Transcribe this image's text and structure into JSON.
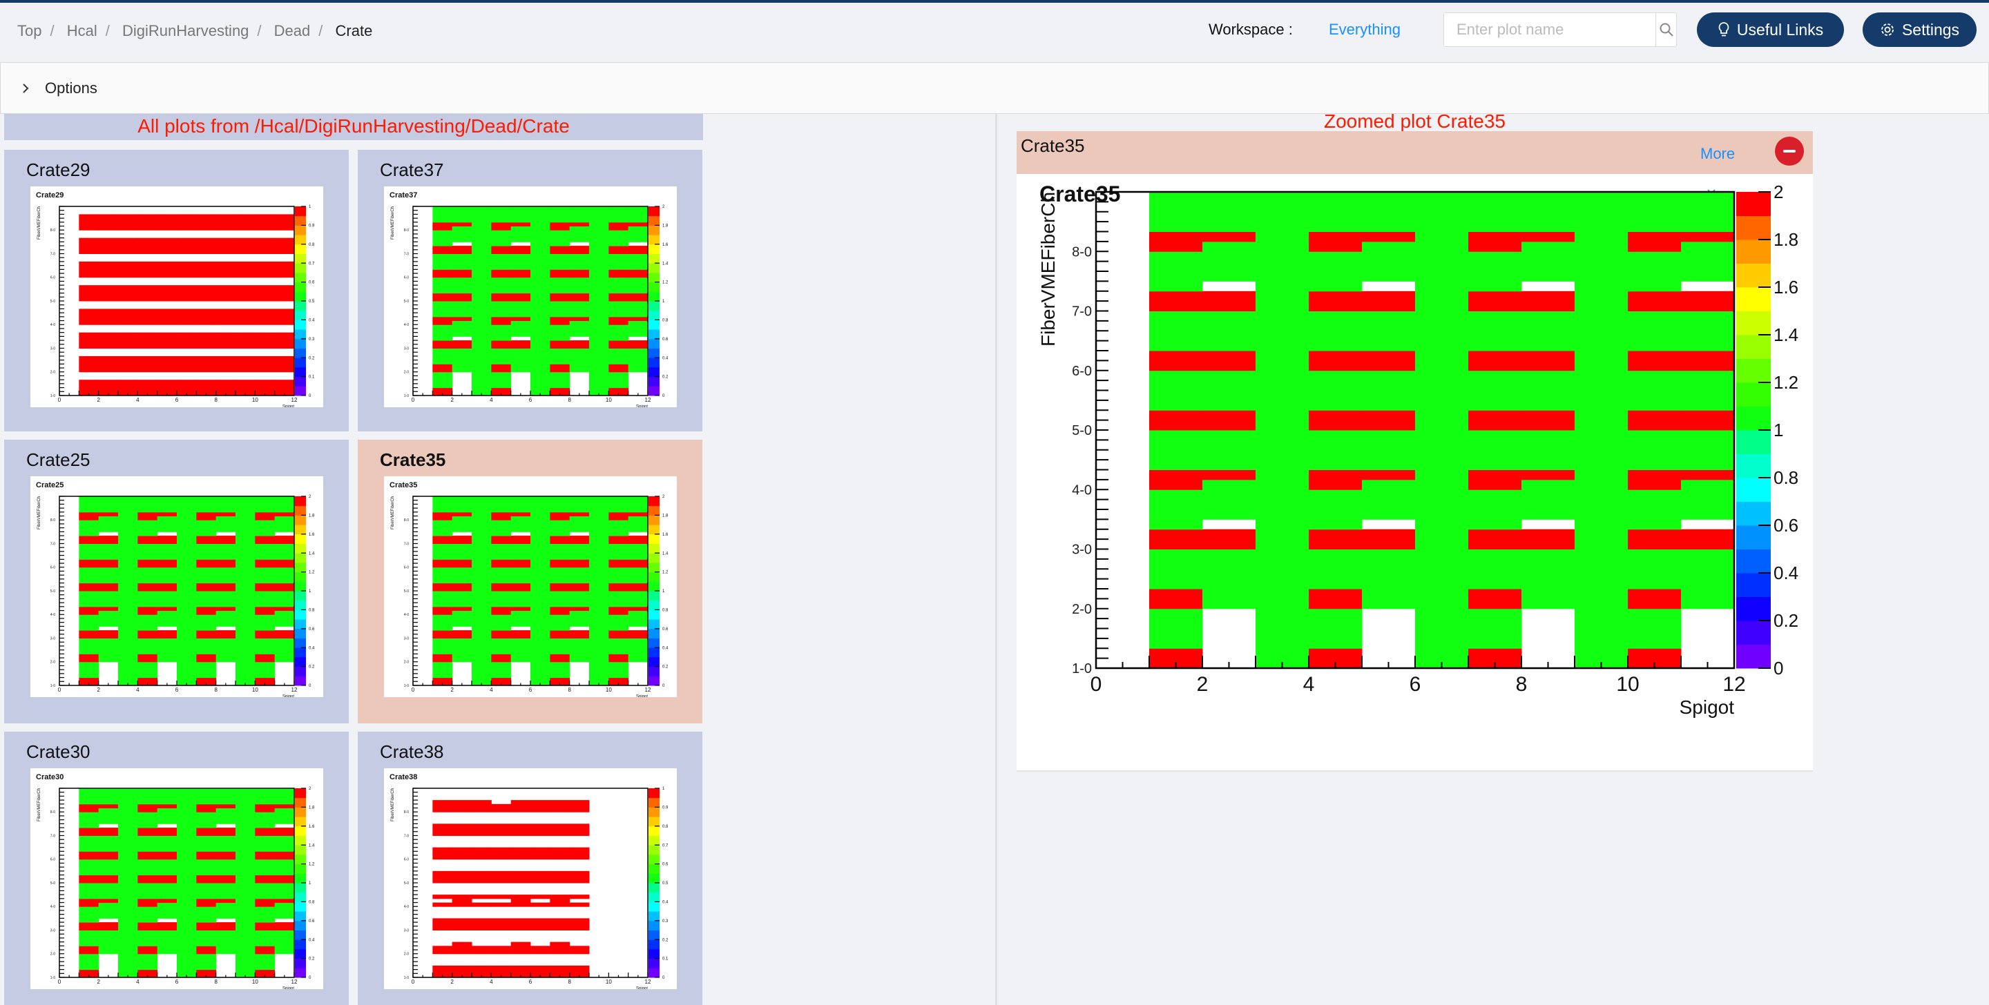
{
  "header": {
    "breadcrumb": [
      "Top",
      "Hcal",
      "DigiRunHarvesting",
      "Dead",
      "Crate"
    ],
    "workspace_label": "Workspace :",
    "workspace_value": "Everything",
    "search_placeholder": "Enter plot name",
    "useful_links": "Useful Links",
    "settings": "Settings"
  },
  "options": {
    "label": "Options"
  },
  "left": {
    "heading": "All plots from /Hcal/DigiRunHarvesting/Dead/Crate"
  },
  "right": {
    "heading": "Zoomed plot Crate35",
    "card_title": "Crate35",
    "more": "More"
  },
  "palette": [
    "#7000ff",
    "#4000ff",
    "#1000ff",
    "#0030ff",
    "#0060ff",
    "#0090ff",
    "#00c0ff",
    "#00ffff",
    "#00ffcc",
    "#00ff88",
    "#11ff11",
    "#33ff00",
    "#66ff00",
    "#99ff00",
    "#ccff00",
    "#ffff00",
    "#ffcc00",
    "#ff9900",
    "#ff6600",
    "#ff0000"
  ],
  "chart_data": {
    "type": "heatmap",
    "xlabel": "Spigot",
    "ylabel": "FiberVMEFiberCh",
    "xlim": [
      0,
      12
    ],
    "x_ticks": [
      "0",
      "2",
      "4",
      "6",
      "8",
      "10",
      "12"
    ],
    "y_ticks": [
      "1-0",
      "2-0",
      "3-0",
      "4-0",
      "5-0",
      "6-0",
      "7-0",
      "8-0"
    ],
    "grids": {
      "A": [
        ".2.12.12.12.",
        ".2.12.12.12.",
        ".1.11.11.11.",
        ".1.11.11.11.",
        ".1.11.11.11.",
        ".1.11.11.11.",
        ".21121121121",
        ".21121121121",
        ".11111111111",
        ".11111111111",
        ".11111111111",
        ".11111111111",
        ".22122122122",
        ".22122122122",
        ".1.11.11.11.",
        ".11111111111",
        ".11111111111",
        ".11111111111",
        ".21121121121",
        ".22122122122",
        ".11111111111",
        ".11111111111",
        ".11111111111",
        ".11111111111",
        ".22122122122",
        ".22122122122",
        ".11111111111",
        ".11111111111",
        ".11111111111",
        ".11111111111",
        ".22122122122",
        ".22122122122",
        ".11111111111",
        ".11111111111",
        ".11111111111",
        ".11111111111",
        ".22122122122",
        ".22122122122",
        ".1.11.11.11.",
        ".11111111111",
        ".11111111111",
        ".11111111111",
        ".21121121121",
        ".22122122122",
        ".11111111111",
        ".11111111111",
        ".11111111111",
        ".11111111111"
      ],
      "B": [
        ".11111111111",
        ".11111111111",
        ".11111111111",
        ".11111111111",
        "............",
        "............",
        ".11111111111",
        ".11111111111",
        ".11111111111",
        ".11111111111",
        "............",
        "............",
        ".11111111111",
        ".11111111111",
        ".11111111111",
        ".11111111111",
        "............",
        "............",
        ".11111111111",
        ".11111111111",
        ".11111111111",
        ".11111111111",
        "............",
        "............",
        ".11111111111",
        ".11111111111",
        ".11111111111",
        ".11111111111",
        "............",
        "............",
        ".11111111111",
        ".11111111111",
        ".11111111111",
        ".11111111111",
        "............",
        "............",
        ".11111111111",
        ".11111111111",
        ".11111111111",
        ".11111111111",
        "............",
        "............",
        ".11111111111",
        ".11111111111",
        ".11111111111",
        ".11111111111",
        "............",
        "............"
      ],
      "C": [
        ".11111111...",
        ".11111111...",
        ".11111111...",
        "............",
        "............",
        "............",
        ".11111111...",
        ".11111111...",
        "..1..1.1....",
        "............",
        "............",
        "............",
        ".11111111...",
        ".11111111...",
        ".11111111...",
        "............",
        "............",
        "............",
        ".11111111...",
        "..1..1.1....",
        ".11111111...",
        "............",
        "............",
        "............",
        ".11111111...",
        ".11111111...",
        ".11111111...",
        "............",
        "............",
        "............",
        ".11111111...",
        ".11111111...",
        ".11111111...",
        "............",
        "............",
        "............",
        ".11111111...",
        ".11111111...",
        ".11111111...",
        "............",
        "............",
        "............",
        ".11111111...",
        ".11111111...",
        ".111.1111...",
        "............",
        "............",
        "............"
      ]
    },
    "plots": [
      {
        "name": "Crate29",
        "grid": "B",
        "zmax": 1,
        "z_ticks": [
          "0",
          "0.1",
          "0.2",
          "0.3",
          "0.4",
          "0.5",
          "0.6",
          "0.7",
          "0.8",
          "0.9",
          "1"
        ]
      },
      {
        "name": "Crate37",
        "grid": "A",
        "zmax": 2,
        "z_ticks": [
          "0",
          "0.2",
          "0.4",
          "0.6",
          "0.8",
          "1",
          "1.2",
          "1.4",
          "1.6",
          "1.8",
          "2"
        ]
      },
      {
        "name": "Crate25",
        "grid": "A",
        "zmax": 2,
        "z_ticks": [
          "0",
          "0.2",
          "0.4",
          "0.6",
          "0.8",
          "1",
          "1.2",
          "1.4",
          "1.6",
          "1.8",
          "2"
        ]
      },
      {
        "name": "Crate35",
        "grid": "A",
        "zmax": 2,
        "selected": true,
        "z_ticks": [
          "0",
          "0.2",
          "0.4",
          "0.6",
          "0.8",
          "1",
          "1.2",
          "1.4",
          "1.6",
          "1.8",
          "2"
        ]
      },
      {
        "name": "Crate30",
        "grid": "A",
        "zmax": 2,
        "z_ticks": [
          "0",
          "0.2",
          "0.4",
          "0.6",
          "0.8",
          "1",
          "1.2",
          "1.4",
          "1.6",
          "1.8",
          "2"
        ]
      },
      {
        "name": "Crate38",
        "grid": "C",
        "zmax": 1,
        "z_ticks": [
          "0",
          "0.1",
          "0.2",
          "0.3",
          "0.4",
          "0.5",
          "0.6",
          "0.7",
          "0.8",
          "0.9",
          "1"
        ]
      }
    ]
  }
}
